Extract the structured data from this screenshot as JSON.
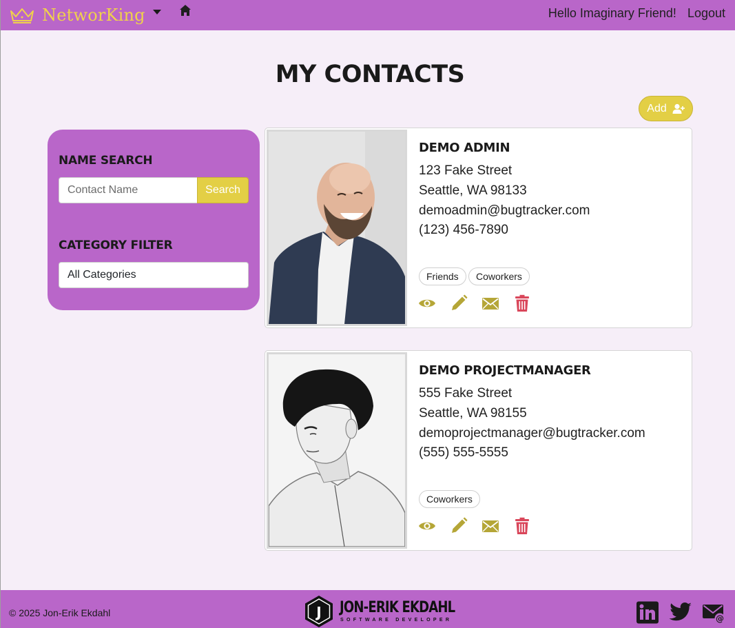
{
  "colors": {
    "nav_bg": "#b966c9",
    "accent": "#e3cf45",
    "brand_text": "#f0d24a",
    "page_bg": "#f6eef8",
    "action_icon": "#b5a637",
    "delete_icon": "#d9465a"
  },
  "navbar": {
    "brand": "NetworKing",
    "greeting": "Hello Imaginary Friend!",
    "logout": "Logout",
    "icons": [
      "crown-icon",
      "caret-down-icon",
      "home-icon"
    ]
  },
  "page": {
    "title": "MY CONTACTS",
    "add_label": "Add"
  },
  "sidebar": {
    "search_heading": "NAME SEARCH",
    "search_placeholder": "Contact Name",
    "search_value": "",
    "search_button": "Search",
    "category_heading": "CATEGORY FILTER",
    "category_selected": "All Categories"
  },
  "contacts": [
    {
      "name": "DEMO ADMIN",
      "street": "123 Fake Street",
      "city": "Seattle, WA 98133",
      "email": "demoadmin@bugtracker.com",
      "phone": "(123) 456-7890",
      "tags": [
        "Friends",
        "Coworkers"
      ],
      "photo": "smiling bald bearded man in blazer"
    },
    {
      "name": "DEMO PROJECTMANAGER",
      "street": "555 Fake Street",
      "city": "Seattle, WA 98155",
      "email": "demoprojectmanager@bugtracker.com",
      "phone": "(555) 555-5555",
      "tags": [
        "Coworkers"
      ],
      "photo": "black and white portrait of man looking down"
    }
  ],
  "footer": {
    "copyright": "© 2025 Jon-Erik Ekdahl",
    "logo_name": "JON-ERIK EKDAHL",
    "logo_subtitle": "SOFTWARE DEVELOPER",
    "logo_letter": "J",
    "social_icons": [
      "linkedin-icon",
      "twitter-icon",
      "email-icon"
    ]
  }
}
